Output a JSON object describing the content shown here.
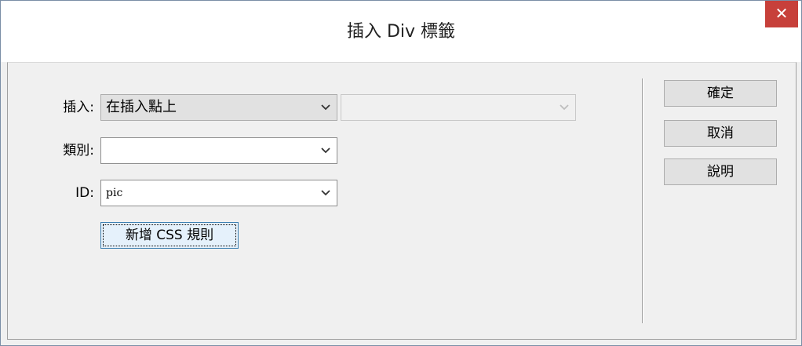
{
  "window": {
    "title": "插入 Div 標籤",
    "close_label": "✕"
  },
  "form": {
    "insert": {
      "label": "插入:",
      "value": "在插入點上",
      "secondary_value": ""
    },
    "class": {
      "label": "類別:",
      "value": ""
    },
    "id": {
      "label": "ID:",
      "value": "pic"
    },
    "new_css_rule_label": "新增 CSS 規則"
  },
  "buttons": {
    "ok_label": "確定",
    "cancel_label": "取消",
    "help_label": "說明"
  },
  "icons": {
    "close": "close-icon",
    "dropdown": "chevron-down-icon"
  },
  "colors": {
    "close_button": "#c7403a",
    "focus_border": "#3c7fb1"
  }
}
